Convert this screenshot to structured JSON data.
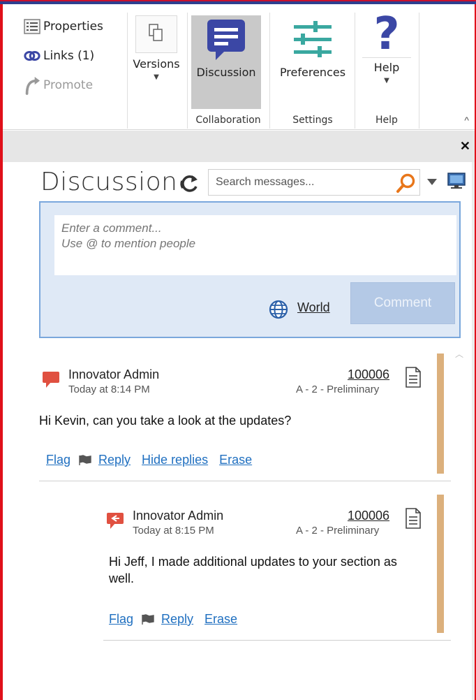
{
  "ribbon": {
    "properties_label": "Properties",
    "links_label": "Links (1)",
    "promote_label": "Promote",
    "versions_label": "Versions",
    "discussion_label": "Discussion",
    "preferences_label": "Preferences",
    "help_label": "Help",
    "groups": {
      "collaboration": "Collaboration",
      "settings": "Settings",
      "help": "Help"
    }
  },
  "panel": {
    "title": "Discussion",
    "search_placeholder": "Search messages...",
    "comment_placeholder": "Enter a comment...\nUse @ to mention people",
    "visibility_label": "World",
    "comment_button": "Comment"
  },
  "messages": [
    {
      "author": "Innovator Admin",
      "time": "Today at 8:14 PM",
      "item_number": "100006",
      "revision": "A - 2 - Preliminary",
      "body": "Hi Kevin, can you take a look at the updates?",
      "actions": {
        "flag": "Flag",
        "reply": "Reply",
        "hide_replies": "Hide replies",
        "erase": "Erase"
      }
    },
    {
      "author": "Innovator Admin",
      "time": "Today at 8:15 PM",
      "item_number": "100006",
      "revision": "A - 2 - Preliminary",
      "body": "Hi Jeff, I made additional updates to your section as well.",
      "actions": {
        "flag": "Flag",
        "reply": "Reply",
        "erase": "Erase"
      }
    }
  ],
  "colors": {
    "accent_blue": "#3b47a5",
    "teal": "#3aa8a0",
    "flag_red": "#e05040",
    "link_blue": "#1f6fc0",
    "thread_bar": "#dcb07c",
    "search_orange": "#e8761a"
  }
}
